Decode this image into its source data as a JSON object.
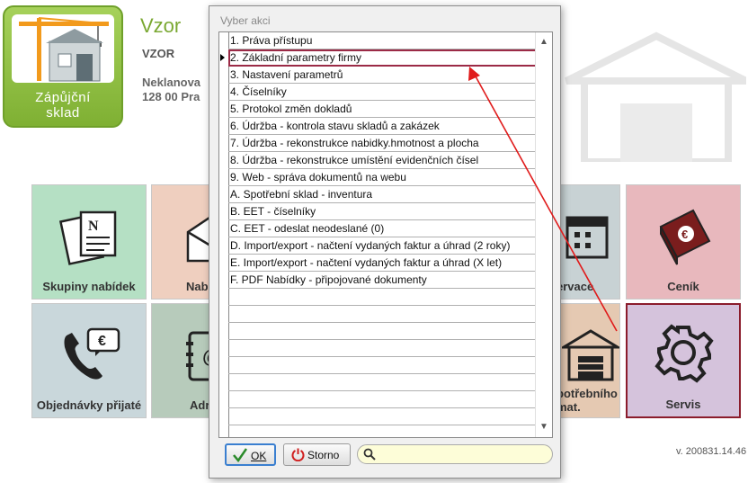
{
  "app": {
    "logo_text_line1": "Zápůjční",
    "logo_text_line2": "sklad",
    "company_title": "Vzor",
    "company_code": "VZOR",
    "address_line1": "Neklanova",
    "address_line2": "128 00 Pra",
    "version": "v. 200831.14.46"
  },
  "tiles": [
    {
      "label": "Skupiny nabídek",
      "icon": "offer-documents-icon"
    },
    {
      "label": "Nab",
      "icon": "envelope-icon"
    },
    {
      "label": "ervace",
      "icon": "calendar-icon"
    },
    {
      "label": "Ceník",
      "icon": "euro-book-icon"
    },
    {
      "label": "Objednávky přijaté",
      "icon": "phone-euro-icon"
    },
    {
      "label": "Adr",
      "icon": "address-book-icon"
    },
    {
      "label_line1": "potřebního",
      "label_line2": "mat.",
      "icon": "warehouse-icon"
    },
    {
      "label": "Servis",
      "icon": "gear-icon"
    }
  ],
  "dialog": {
    "title": "Vyber akci",
    "items": [
      "1. Práva přístupu",
      "2. Základní parametry firmy",
      "3. Nastavení parametrů",
      "4. Číselníky",
      "5. Protokol změn dokladů",
      "6. Údržba - kontrola stavu skladů a zakázek",
      "7. Údržba - rekonstrukce nabidky.hmotnost a plocha",
      "8. Údržba - rekonstrukce umístění evidenčních čísel",
      "9. Web - správa dokumentů na webu",
      "A. Spotřební sklad - inventura",
      "B. EET - číselníky",
      "C. EET - odeslat neodeslané (0)",
      "D. Import/export  - načtení vydaných faktur a úhrad (2 roky)",
      "E. Import/export  - načtení vydaných faktur a úhrad (X let)",
      "F. PDF Nabídky - připojované dokumenty"
    ],
    "selected_index": 1,
    "ok_label": "OK",
    "storno_label": "Storno",
    "search_placeholder": ""
  },
  "colors": {
    "highlight": "#9b2a46",
    "annotation_arrow": "#e01b1b",
    "logo_green": "#8cc043"
  }
}
